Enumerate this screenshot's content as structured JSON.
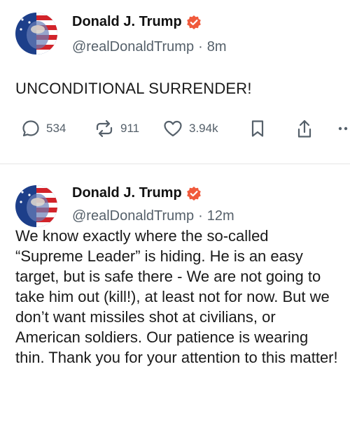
{
  "posts": [
    {
      "author": {
        "name": "Donald J. Trump",
        "handle": "@realDonaldTrump",
        "avatar_icon": "profile-avatar"
      },
      "separator": "·",
      "time_ago": "8m",
      "text": "UNCONDITIONAL SURRENDER!",
      "actions": {
        "reply_count": "534",
        "repost_count": "911",
        "like_count": "3.94k"
      }
    },
    {
      "author": {
        "name": "Donald J. Trump",
        "handle": "@realDonaldTrump",
        "avatar_icon": "profile-avatar"
      },
      "separator": "·",
      "time_ago": "12m",
      "text": "We know exactly where the so-called “Supreme Leader” is hiding. He is an easy target, but is safe there - We are not going to take him out (kill!), at least not for now. But we don’t want missiles shot at civilians, or American soldiers. Our patience is wearing thin. Thank you for your attention to this matter!"
    }
  ],
  "colors": {
    "verified_badge": "#f05a3c",
    "muted_text": "#55606a",
    "divider": "#e6e6e6"
  },
  "icons": [
    "reply-icon",
    "repost-icon",
    "like-icon",
    "bookmark-icon",
    "share-icon",
    "more-icon",
    "verified-badge-icon"
  ]
}
